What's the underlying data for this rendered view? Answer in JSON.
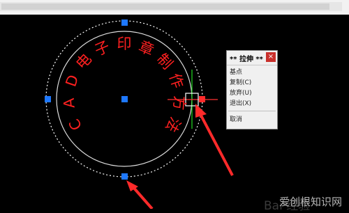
{
  "stamp": {
    "text_chars": [
      "C",
      "A",
      "D",
      "电",
      "子",
      "印",
      "章",
      "制",
      "作",
      "方",
      "法"
    ],
    "text_color": "#ff2020",
    "grip_color": "#1e78ff",
    "hot_grip_color": "#ff2a2a"
  },
  "context_menu": {
    "title": "** 拉伸 **",
    "close_label": "×",
    "items": [
      "基点",
      "复制(C)",
      "放弃(U)",
      "退出(X)",
      "取消"
    ]
  },
  "watermark": {
    "text": "爱创根知识网",
    "text_faint": "Bai 经验"
  }
}
